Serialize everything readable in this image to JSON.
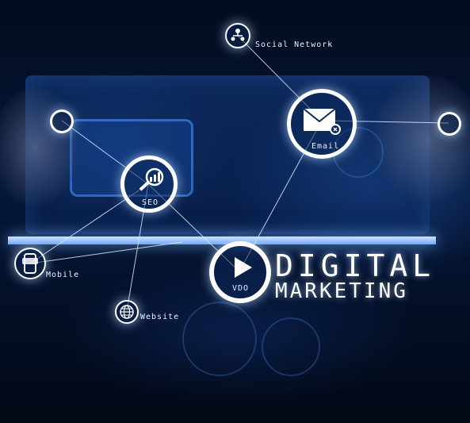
{
  "nodes": {
    "social_network": {
      "label": "Social Network",
      "icon": "people-network-icon"
    },
    "email": {
      "label": "Email",
      "icon": "envelope-icon"
    },
    "seo": {
      "label": "SEO",
      "icon": "seo-chart-magnifier-icon"
    },
    "mobile": {
      "label": "Mobile",
      "icon": "smartphone-icon"
    },
    "website": {
      "label": "Website",
      "icon": "globe-icon"
    },
    "vdo": {
      "label": "VDO",
      "icon": "play-icon"
    }
  },
  "headline": {
    "line1": "DIGITAL",
    "line2": "MARKETING"
  },
  "colors": {
    "background": "#041029",
    "accent": "#3a8dff",
    "node_ring": "#ffffff"
  }
}
